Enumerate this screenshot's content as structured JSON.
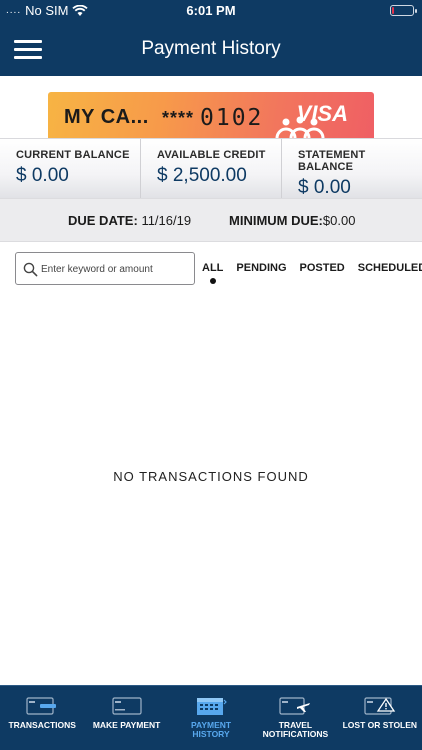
{
  "status_bar": {
    "carrier": "No SIM",
    "signal_dots": "....",
    "time": "6:01 PM",
    "battery_level_percent": 10,
    "battery_color": "#e0334b"
  },
  "nav": {
    "title": "Payment History",
    "menu_icon": "hamburger-menu-icon"
  },
  "card": {
    "name": "MY CA...",
    "mask": "****",
    "last_four": "0102",
    "network": "VISA"
  },
  "balances": {
    "current_label": "CURRENT BALANCE",
    "current_value": "$ 0.00",
    "available_label": "AVAILABLE CREDIT",
    "available_value": "$ 2,500.00",
    "statement_label": "STATEMENT BALANCE",
    "statement_value": "$ 0.00"
  },
  "due": {
    "date_label": "DUE DATE:",
    "date_value": "11/16/19",
    "minimum_label": "MINIMUM DUE:",
    "minimum_value": "$0.00"
  },
  "search": {
    "placeholder": "Enter keyword or amount",
    "value": ""
  },
  "filters": [
    {
      "label": "ALL",
      "active": true
    },
    {
      "label": "PENDING",
      "active": false
    },
    {
      "label": "POSTED",
      "active": false
    },
    {
      "label": "SCHEDULED",
      "active": false
    }
  ],
  "empty_message": "NO TRANSACTIONS FOUND",
  "tab_bar": [
    {
      "label": "TRANSACTIONS",
      "icon": "card-minus-icon",
      "active": false
    },
    {
      "label": "MAKE PAYMENT",
      "icon": "card-icon",
      "active": false
    },
    {
      "label": "PAYMENT HISTORY",
      "icon": "calendar-icon",
      "active": true
    },
    {
      "label": "TRAVEL NOTIFICATIONS",
      "icon": "airplane-card-icon",
      "active": false
    },
    {
      "label": "LOST OR STOLEN",
      "icon": "card-warning-icon",
      "active": false
    }
  ],
  "colors": {
    "brand_navy": "#0e3a63",
    "active_tab": "#58a8ee",
    "balance_value": "#0e3a63"
  }
}
